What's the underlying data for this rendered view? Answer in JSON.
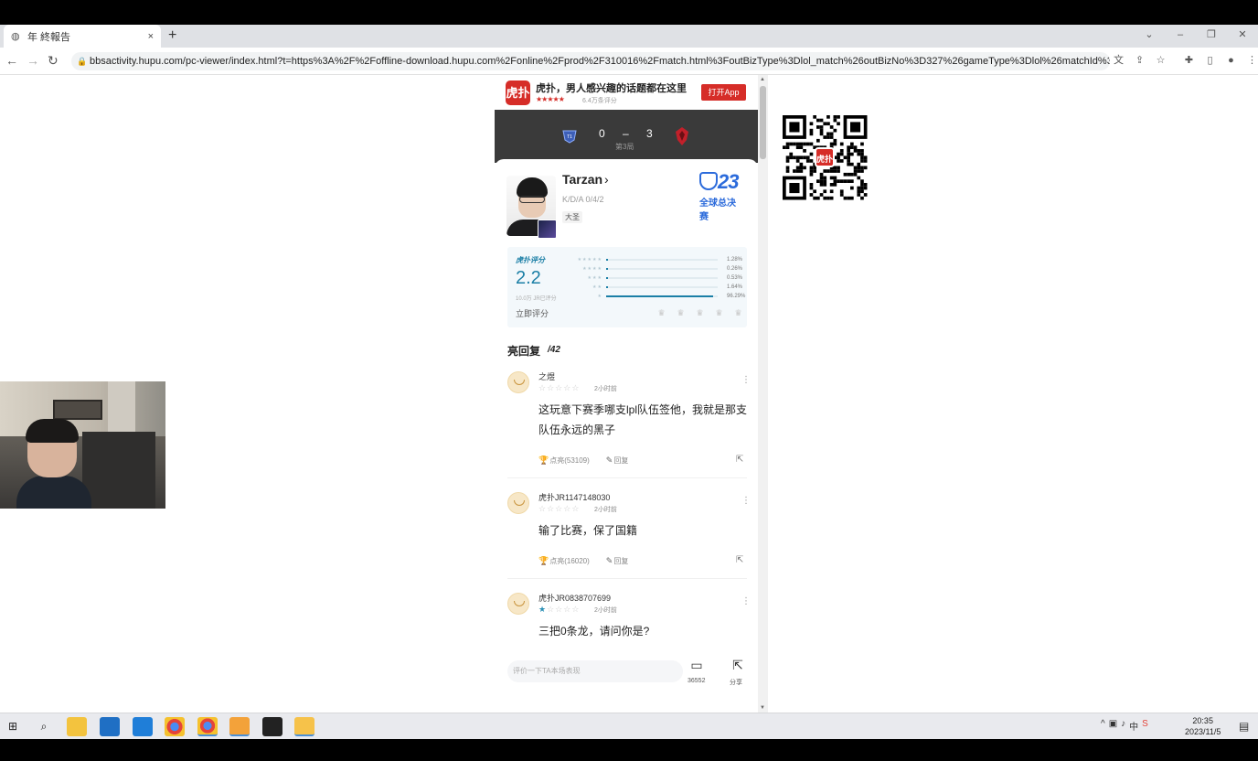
{
  "browser": {
    "tab_title": "年 終報告",
    "tab_close": "×",
    "new_tab": "+",
    "url": "bbsactivity.hupu.com/pc-viewer/index.html?t=https%3A%2F%2Foffline-download.hupu.com%2Fonline%2Fprod%2F310016%2Fmatch.html%3FoutBizType%3Dlol_match%26outBizNo%3D327%26gameType%3Dlol%26matchId%3...",
    "window_controls": [
      "⌄",
      "–",
      "❐",
      "✕"
    ]
  },
  "app_banner": {
    "logo_text": "虎扑",
    "slogan": "虎扑，男人感兴趣的话题都在这里",
    "stars": "★★★★★",
    "rating_text": "6.4万条评分",
    "open_app_label": "打开App"
  },
  "match": {
    "score_left": "0",
    "score_dash": "–",
    "score_right": "3",
    "game_no": "第3局"
  },
  "player": {
    "name": "Tarzan",
    "kda": "K/D/A 0/4/2",
    "role": "大圣",
    "event_logo_num": "23",
    "event_logo_text": "全球总决赛"
  },
  "rating": {
    "label": "虎扑评分",
    "score": "2.2",
    "count_text": "10.0万 JR已评分",
    "rate_now": "立即评分",
    "distribution": [
      {
        "stars": "★★★★★",
        "percent_text": "1.28%",
        "percent": 1.28
      },
      {
        "stars": "★★★★",
        "percent_text": "0.26%",
        "percent": 0.26
      },
      {
        "stars": "★★★",
        "percent_text": "0.53%",
        "percent": 0.53
      },
      {
        "stars": "★★",
        "percent_text": "1.64%",
        "percent": 1.64
      },
      {
        "stars": "★",
        "percent_text": "96.29%",
        "percent": 96.29
      }
    ]
  },
  "replies": {
    "title": "亮回复",
    "count": "/42",
    "items": [
      {
        "user": "之煜",
        "stars_on": 0,
        "time": "2小时前",
        "body": "这玩意下赛季哪支lpl队伍签他，我就是那支队伍永远的黑子",
        "likes": "点亮(53109)",
        "reply": "回复"
      },
      {
        "user": "虎扑JR1147148030",
        "stars_on": 0,
        "time": "2小时前",
        "body": "输了比赛，保了国籍",
        "likes": "点亮(16020)",
        "reply": "回复"
      },
      {
        "user": "虎扑JR0838707699",
        "stars_on": 1,
        "time": "2小时前",
        "body": "三把0条龙，请问你是?",
        "likes": "",
        "reply": ""
      }
    ]
  },
  "bottom_bar": {
    "input_placeholder": "评价一下TA本场表现",
    "comment_count": "36552",
    "share_label": "分享"
  },
  "qr": {
    "center_text": "虎扑"
  },
  "taskbar": {
    "time": "20:35",
    "date": "2023/11/5",
    "ime": "中"
  }
}
